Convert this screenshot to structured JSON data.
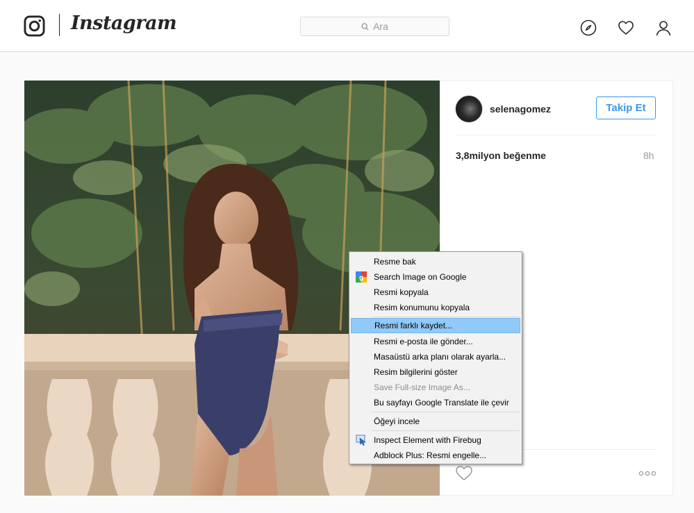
{
  "header": {
    "wordmark": "Instagram",
    "search_placeholder": "Ara"
  },
  "post": {
    "username": "selenagomez",
    "follow_label": "Takip Et",
    "likes": "3,8milyon beğenme",
    "time": "8h"
  },
  "context_menu": {
    "items": [
      {
        "label": "Resme bak"
      },
      {
        "label": "Search Image on Google",
        "icon": "google-icon"
      },
      {
        "label": "Resmi kopyala"
      },
      {
        "label": "Resim konumunu kopyala"
      },
      {
        "label": "Resmi farklı kaydet...",
        "highlighted": true
      },
      {
        "label": "Resmi e-posta ile gönder..."
      },
      {
        "label": "Masaüstü arka planı olarak ayarla..."
      },
      {
        "label": "Resim bilgilerini göster"
      },
      {
        "label": "Save Full-size Image As...",
        "disabled": true
      },
      {
        "label": "Bu sayfayı Google Translate ile çevir"
      },
      {
        "label": "Öğeyi incele"
      },
      {
        "label": "Inspect Element with Firebug",
        "icon": "firebug-icon"
      },
      {
        "label": "Adblock Plus: Resmi engelle..."
      }
    ]
  },
  "colors": {
    "accent": "#3897f0",
    "menu_highlight": "#91c9f7",
    "text_primary": "#262626",
    "text_secondary": "#999999"
  }
}
